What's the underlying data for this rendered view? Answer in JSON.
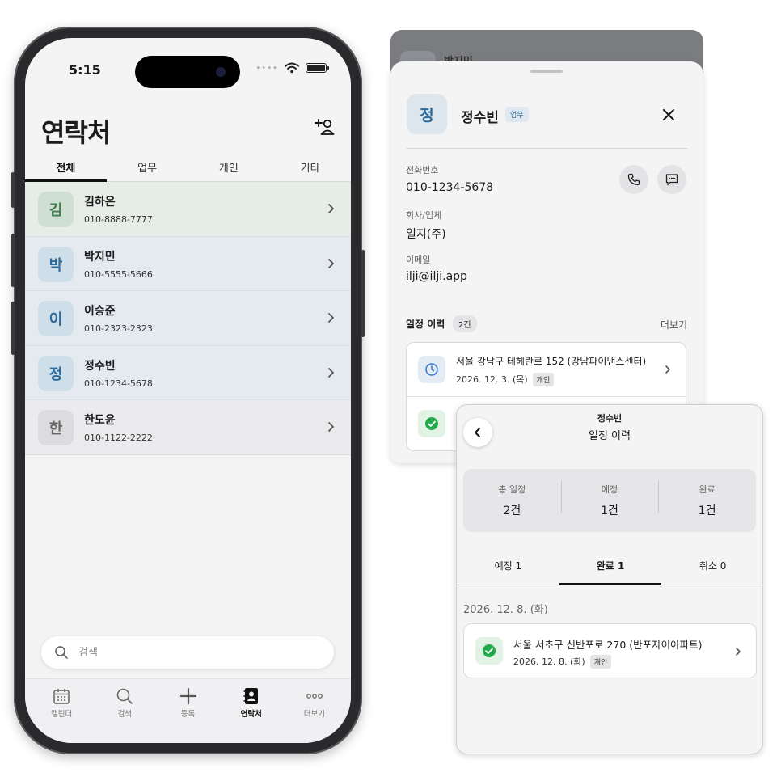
{
  "status": {
    "time": "5:15"
  },
  "contacts_page": {
    "title": "연락처",
    "tabs": [
      "전체",
      "업무",
      "개인",
      "기타"
    ],
    "contacts": [
      {
        "initial": "김",
        "name": "김하은",
        "phone": "010-8888-7777",
        "bg": "#e6ede7",
        "avatar_bg": "#cfe0d2",
        "avatar_fg": "#3f7d4f"
      },
      {
        "initial": "박",
        "name": "박지민",
        "phone": "010-5555-5666",
        "bg": "#e4eaef",
        "avatar_bg": "#cfdfea",
        "avatar_fg": "#2c6a9c"
      },
      {
        "initial": "이",
        "name": "이승준",
        "phone": "010-2323-2323",
        "bg": "#e4eaef",
        "avatar_bg": "#cfdfea",
        "avatar_fg": "#2c6a9c"
      },
      {
        "initial": "정",
        "name": "정수빈",
        "phone": "010-1234-5678",
        "bg": "#e4eaef",
        "avatar_bg": "#cfdfea",
        "avatar_fg": "#2c6a9c"
      },
      {
        "initial": "한",
        "name": "한도윤",
        "phone": "010-1122-2222",
        "bg": "#ebebed",
        "avatar_bg": "#dcdcdf",
        "avatar_fg": "#666666"
      }
    ],
    "search_placeholder": "검색",
    "tabbar": [
      "캘린더",
      "검색",
      "등록",
      "연락처",
      "더보기"
    ]
  },
  "detail": {
    "peek_name": "박지민",
    "initial": "정",
    "name": "정수빈",
    "badge": "업무",
    "phone_label": "전화번호",
    "phone": "010-1234-5678",
    "company_label": "회사/업체",
    "company": "일지(주)",
    "email_label": "이메일",
    "email": "ilji@ilji.app",
    "history_title": "일정 이력",
    "history_count": "2건",
    "more": "더보기",
    "history_items": [
      {
        "address": "서울 강남구 테헤란로 152 (강남파이낸스센터)",
        "date": "2026. 12. 3. (목)",
        "tag": "개인"
      }
    ]
  },
  "history_panel": {
    "subtitle": "정수빈",
    "title": "일정 이력",
    "stats": [
      {
        "label": "총 일정",
        "value": "2건"
      },
      {
        "label": "예정",
        "value": "1건"
      },
      {
        "label": "완료",
        "value": "1건"
      }
    ],
    "tabs": [
      "예정 1",
      "완료 1",
      "취소 0"
    ],
    "date_header": "2026. 12. 8. (화)",
    "items": [
      {
        "address": "서울 서초구 신반포로 270 (반포자이아파트)",
        "date": "2026. 12. 8. (화)",
        "tag": "개인"
      }
    ]
  },
  "colors": {
    "accent_blue": "#2c6a9c",
    "success_green": "#1faa4b",
    "clock_blue": "#3a7bd5"
  }
}
